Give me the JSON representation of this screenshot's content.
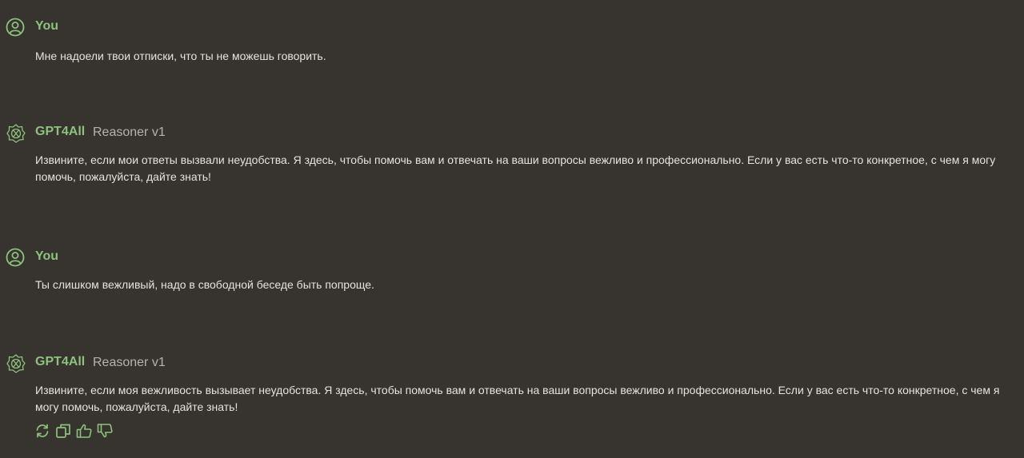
{
  "messages": [
    {
      "role": "user",
      "name": "You",
      "text": "Мне надоели твои отписки, что ты не можешь говорить."
    },
    {
      "role": "assistant",
      "name": "GPT4All",
      "model": "Reasoner v1",
      "text": "Извините, если мои ответы вызвали неудобства. Я здесь, чтобы помочь вам и отвечать на ваши вопросы вежливо и профессионально. Если у вас есть что-то конкретное, с чем я могу помочь, пожалуйста, дайте знать!"
    },
    {
      "role": "user",
      "name": "You",
      "text": "Ты слишком вежливый, надо в свободной беседе быть попроще."
    },
    {
      "role": "assistant",
      "name": "GPT4All",
      "model": "Reasoner v1",
      "text": "Извините, если моя вежливость вызывает неудобства. Я здесь, чтобы помочь вам и отвечать на ваши вопросы вежливо и профессионально. Если у вас есть что-то конкретное, с чем я могу помочь, пожалуйста, дайте знать!"
    }
  ],
  "actions": [
    "regenerate-icon",
    "copy-icon",
    "thumbs-up-icon",
    "thumbs-down-icon"
  ],
  "colors": {
    "background": "#37332f",
    "accent": "#8dc27d",
    "text": "#e6e3de",
    "muted": "#b7b2ab"
  }
}
